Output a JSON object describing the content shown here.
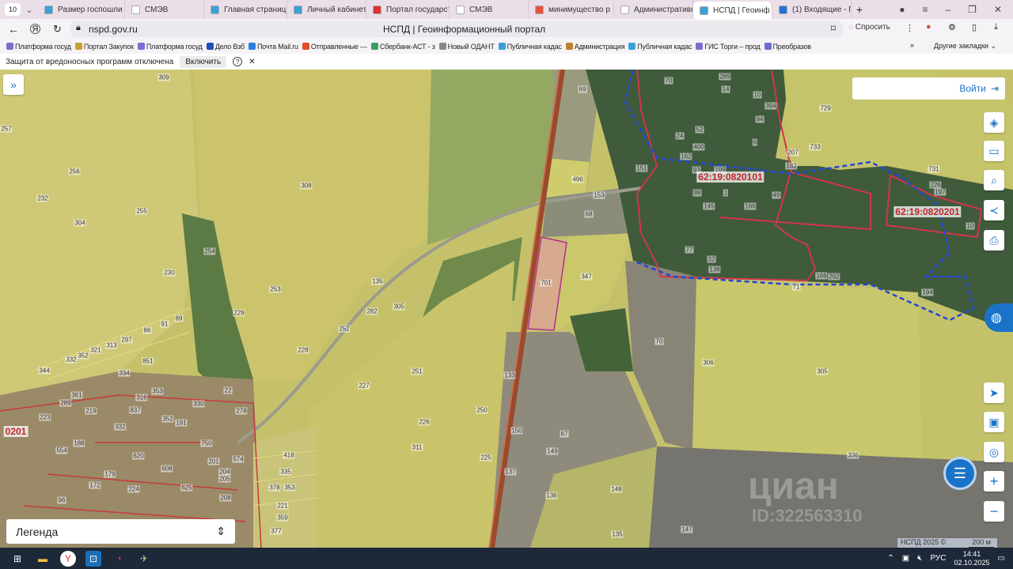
{
  "browser": {
    "tab_count": "10",
    "tabs": [
      {
        "label": "Размер госпошли",
        "color": "#3aa0d8"
      },
      {
        "label": "СМЭВ",
        "color": "#ffffff"
      },
      {
        "label": "Главная страниц",
        "color": "#3aa0d8"
      },
      {
        "label": "Личный кабинет",
        "color": "#3aa0d8"
      },
      {
        "label": "Портал государст",
        "color": "#d33"
      },
      {
        "label": "СМЭВ",
        "color": "#ffffff"
      },
      {
        "label": "минимущество р",
        "color": "#e5533d"
      },
      {
        "label": "Административн",
        "color": "#ffffff"
      },
      {
        "label": "НСПД | Геоинф",
        "color": "#3aa0d8"
      },
      {
        "label": "(1) Входящие - По",
        "color": "#2a6fd6"
      }
    ],
    "url": "nspd.gov.ru",
    "page_title": "НСПД | Геоинформационный портал",
    "ask_label": "Спросить",
    "bookmarks": [
      "Платформа госуд",
      "Портал Закупок",
      "Платформа госуд",
      "Дело Взб",
      "Почта Mail.ru",
      "Отправленные —",
      "Сбербанк-АСТ - з",
      "Новый ОДАНТ",
      "Публичная кадас",
      "Администрация",
      "Публичная кадас",
      "ГИС Торги – прод",
      "Преобразов"
    ],
    "other_bookmarks": "Другие закладки",
    "protection_text": "Защита от вредоносных программ отключена",
    "enable_label": "Включить"
  },
  "map": {
    "login_label": "Войти",
    "legend_label": "Легенда",
    "copyright": "НСПД 2025 ©",
    "scale": "200 м",
    "watermark": "циан",
    "watermark_id": "ID:322563310",
    "cadastral_quarters": [
      "62:19:0820101",
      "62:19:0820201",
      "0201"
    ],
    "parcels": [
      "309",
      "257",
      "256",
      "232",
      "304",
      "255",
      "308",
      "254",
      "230",
      "253",
      "229",
      "135",
      "282",
      "305",
      "252",
      "228",
      "89",
      "91",
      "86",
      "297",
      "313",
      "321",
      "352",
      "332",
      "851",
      "334",
      "344",
      "353",
      "316",
      "289",
      "361",
      "330",
      "22",
      "278",
      "227",
      "251",
      "133",
      "250",
      "226",
      "311",
      "225",
      "150",
      "137",
      "67",
      "149",
      "136",
      "148",
      "135",
      "147",
      "70",
      "306",
      "305",
      "336",
      "701",
      "347",
      "496",
      "153",
      "68",
      "69",
      "151",
      "729",
      "733",
      "207",
      "182",
      "731",
      "226",
      "197",
      "10",
      "194",
      "166",
      "292",
      "71",
      "138",
      "32",
      "77",
      "145",
      "166",
      "49",
      "98",
      "1",
      "93",
      "199",
      "162",
      "400",
      "24",
      "52",
      "6",
      "94",
      "394",
      "10",
      "14",
      "289",
      "70",
      "223",
      "219",
      "837",
      "352",
      "191",
      "750",
      "332",
      "574",
      "418",
      "335",
      "378",
      "353",
      "221",
      "359",
      "377",
      "620",
      "608",
      "625",
      "224",
      "179",
      "172",
      "96",
      "204",
      "205",
      "208",
      "201",
      "188",
      "554"
    ]
  },
  "taskbar": {
    "lang": "РУС",
    "time": "14:41",
    "date": "02.10.2025"
  }
}
